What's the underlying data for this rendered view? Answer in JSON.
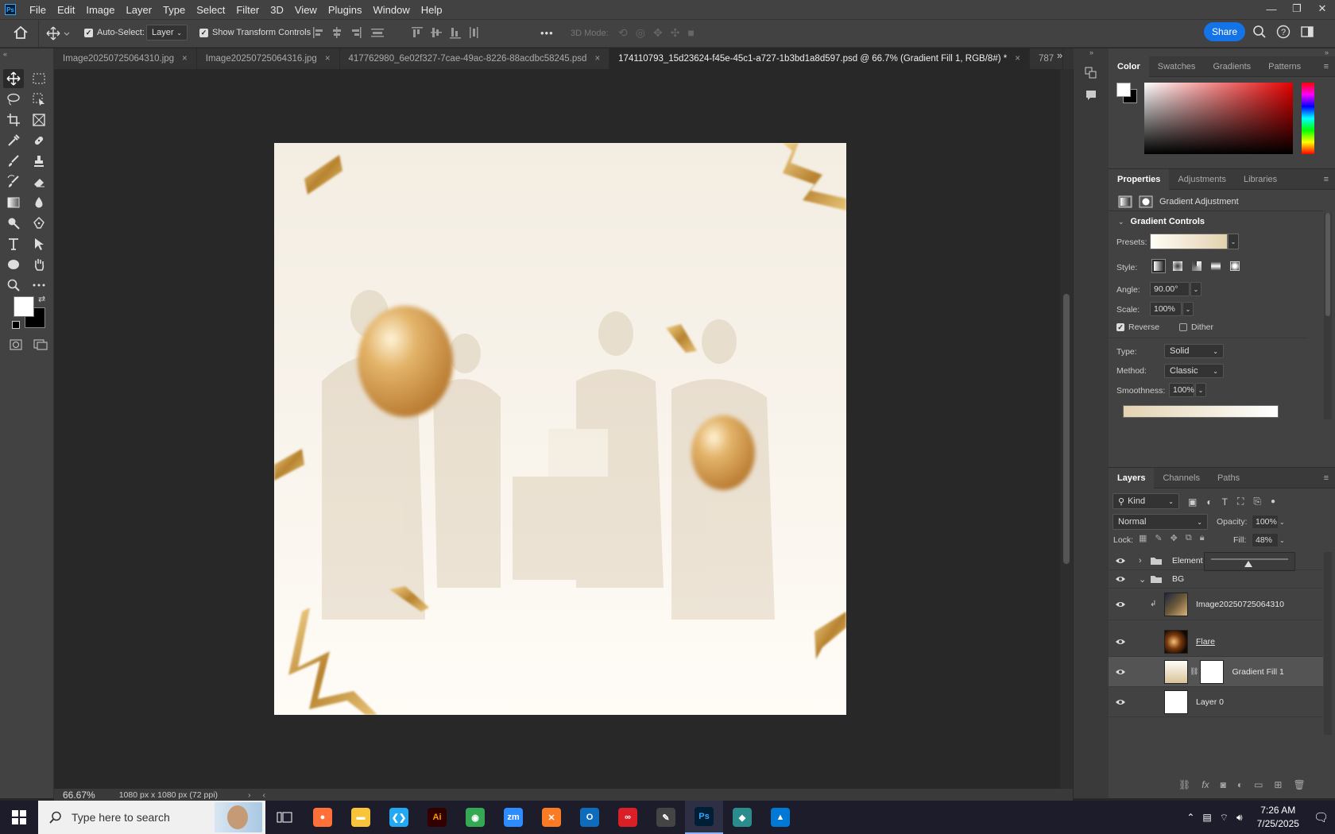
{
  "app": {
    "logo": "Ps",
    "name": "Adobe Photoshop"
  },
  "menu": [
    "File",
    "Edit",
    "Image",
    "Layer",
    "Type",
    "Select",
    "Filter",
    "3D",
    "View",
    "Plugins",
    "Window",
    "Help"
  ],
  "window_controls": [
    "minimize-icon",
    "restore-icon",
    "close-icon"
  ],
  "options": {
    "auto_select_label": "Auto-Select:",
    "auto_select_checked": true,
    "auto_select_target": "Layer",
    "transform_label": "Show Transform Controls",
    "transform_checked": true,
    "mode_3d": "3D Mode:",
    "more": "•••",
    "share": "Share"
  },
  "tabs": [
    {
      "label": "Image20250725064310.jpg",
      "active": false
    },
    {
      "label": "Image20250725064316.jpg",
      "active": false
    },
    {
      "label": "417762980_6e02f327-7cae-49ac-8226-88acdbc58245.psd",
      "active": false
    },
    {
      "label": "174110793_15d23624-f45e-45c1-a727-1b3bd1a8d597.psd @ 66.7% (Gradient Fill 1, RGB/8#) *",
      "active": true
    },
    {
      "label": "787",
      "active": false
    }
  ],
  "tools": [
    "move-tool",
    "marquee-tool",
    "lasso-tool",
    "object-select-tool",
    "crop-tool",
    "frame-tool",
    "eyedropper-tool",
    "healing-tool",
    "brush-tool",
    "stamp-tool",
    "history-brush-tool",
    "eraser-tool",
    "gradient-tool",
    "blur-tool",
    "dodge-tool",
    "pen-tool",
    "type-tool",
    "path-select-tool",
    "ellipse-tool",
    "hand-tool",
    "zoom-tool",
    "more-tools"
  ],
  "status": {
    "zoom": "66.67%",
    "doc_info": "1080 px x 1080 px (72 ppi)"
  },
  "color_panel": {
    "tabs": [
      "Color",
      "Swatches",
      "Gradients",
      "Patterns"
    ],
    "active": "Color",
    "foreground": "#ffffff",
    "background": "#000000"
  },
  "properties": {
    "tabs": [
      "Properties",
      "Adjustments",
      "Libraries"
    ],
    "active": "Properties",
    "title": "Gradient Adjustment",
    "section": "Gradient Controls",
    "presets_label": "Presets:",
    "style_label": "Style:",
    "angle_label": "Angle:",
    "angle": "90.00°",
    "scale_label": "Scale:",
    "scale": "100%",
    "reverse_label": "Reverse",
    "reverse_checked": true,
    "dither_label": "Dither",
    "dither_checked": false,
    "type_label": "Type:",
    "type": "Solid",
    "method_label": "Method:",
    "method": "Classic",
    "smoothness_label": "Smoothness:",
    "smoothness": "100%",
    "gradient_start": "#e4d3b2",
    "gradient_end": "#ffffff"
  },
  "layers_panel": {
    "tabs": [
      "Layers",
      "Channels",
      "Paths"
    ],
    "active": "Layers",
    "filter": "Kind",
    "blend_mode": "Normal",
    "opacity_label": "Opacity:",
    "opacity": "100%",
    "lock_label": "Lock:",
    "fill_label": "Fill:",
    "fill": "48%",
    "fill_level": 0.48,
    "layers": [
      {
        "name": "Element",
        "kind": "group",
        "expanded": false,
        "indent": 0
      },
      {
        "name": "BG",
        "kind": "group",
        "expanded": true,
        "indent": 0
      },
      {
        "name": "Image20250725064310",
        "kind": "smart",
        "indent": 1,
        "clipped": true
      },
      {
        "name": "Flare",
        "kind": "smart",
        "indent": 1
      },
      {
        "name": "Gradient Fill 1",
        "kind": "fill",
        "indent": 1,
        "selected": true
      },
      {
        "name": "Layer 0",
        "kind": "pixel",
        "indent": 1
      }
    ]
  },
  "taskbar": {
    "search_placeholder": "Type here to search",
    "time": "7:26 AM",
    "date": "7/25/2025",
    "apps": [
      {
        "name": "firefox-icon",
        "color": "#ff7139",
        "glyph": "●"
      },
      {
        "name": "file-explorer-icon",
        "color": "#f8c53a",
        "glyph": "▬"
      },
      {
        "name": "vscode-icon",
        "color": "#23a9f2",
        "glyph": "❮❯"
      },
      {
        "name": "illustrator-icon",
        "color": "#330000",
        "glyph": "Ai"
      },
      {
        "name": "chrome-icon",
        "color": "#34a853",
        "glyph": "◉"
      },
      {
        "name": "zoom-icon",
        "color": "#2d8cff",
        "glyph": "zm"
      },
      {
        "name": "xampp-icon",
        "color": "#fb7a24",
        "glyph": "✕"
      },
      {
        "name": "outlook-icon",
        "color": "#0f6cbd",
        "glyph": "O"
      },
      {
        "name": "creative-cloud-icon",
        "color": "#da1f26",
        "glyph": "∞"
      },
      {
        "name": "pen-app-icon",
        "color": "#444444",
        "glyph": "✎"
      },
      {
        "name": "photoshop-icon",
        "color": "#001e36",
        "glyph": "Ps"
      },
      {
        "name": "gem-app-icon",
        "color": "#2a8c8c",
        "glyph": "◆"
      },
      {
        "name": "photos-icon",
        "color": "#0078d4",
        "glyph": "▲"
      }
    ]
  }
}
